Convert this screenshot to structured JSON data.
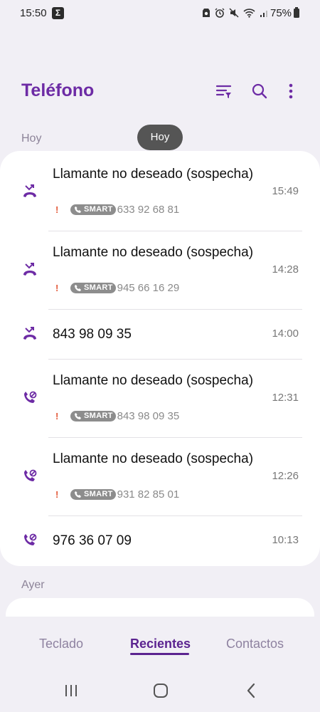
{
  "status_bar": {
    "time": "15:50",
    "notification_icon": "Σ",
    "battery": "75%",
    "icons": [
      "alarm-app-icon",
      "alarm-clock-icon",
      "mute-icon",
      "wifi-icon",
      "signal-icon"
    ]
  },
  "header": {
    "title": "Teléfono",
    "actions": [
      "filter-icon",
      "search-icon",
      "more-options-icon"
    ]
  },
  "tooltip": "Hoy",
  "sections": {
    "today": "Hoy",
    "yesterday": "Ayer"
  },
  "calls": [
    {
      "type": "missed",
      "name": "Llamante no deseado (sospecha)",
      "badge": "SMART",
      "flag": "!",
      "number": "633 92 68 81",
      "time": "15:49"
    },
    {
      "type": "missed",
      "name": "Llamante no deseado (sospecha)",
      "badge": "SMART",
      "flag": "!",
      "number": "945 66 16 29",
      "time": "14:28"
    },
    {
      "type": "missed",
      "name": "843 98 09 35",
      "time": "14:00"
    },
    {
      "type": "blocked",
      "name": "Llamante no deseado (sospecha)",
      "badge": "SMART",
      "flag": "!",
      "number": "843 98 09 35",
      "time": "12:31"
    },
    {
      "type": "blocked",
      "name": "Llamante no deseado (sospecha)",
      "badge": "SMART",
      "flag": "!",
      "number": "931 82 85 01",
      "time": "12:26"
    },
    {
      "type": "blocked",
      "name": "976 36 07 09",
      "time": "10:13"
    }
  ],
  "tabs": [
    {
      "label": "Teclado",
      "active": false
    },
    {
      "label": "Recientes",
      "active": true
    },
    {
      "label": "Contactos",
      "active": false
    }
  ],
  "nav": [
    "recent-apps-icon",
    "home-icon",
    "back-icon"
  ],
  "colors": {
    "accent": "#6d2ba5",
    "background": "#f1eff5",
    "badge": "#8d8d8d",
    "warning": "#e35a3a"
  }
}
